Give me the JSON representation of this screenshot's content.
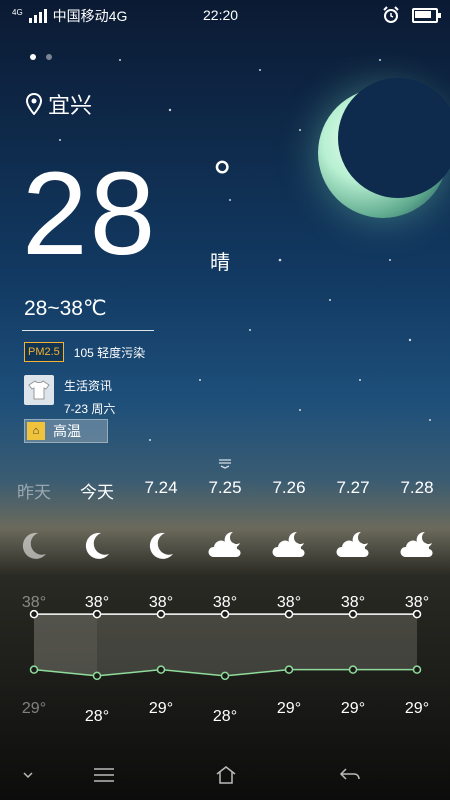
{
  "status": {
    "network": "4G",
    "carrier": "中国移动4G",
    "time": "22:20",
    "alarm_icon": "alarm-clock-icon",
    "battery_icon": "battery-icon"
  },
  "page_dots": [
    true,
    false
  ],
  "city": "宜兴",
  "current": {
    "temperature": "28",
    "degree_symbol": "°",
    "condition": "晴",
    "range": "28~38℃"
  },
  "aqi": {
    "badge": "PM2.5",
    "text": "105 轻度污染"
  },
  "life": {
    "title": "生活资讯",
    "date": "7-23 周六"
  },
  "alert": {
    "label": "高温"
  },
  "forecast": {
    "days": [
      {
        "label": "昨天",
        "icon": "crescent-moon-icon",
        "high": "38°",
        "low": "29°",
        "past": true
      },
      {
        "label": "今天",
        "icon": "crescent-moon-icon",
        "high": "38°",
        "low": "28°",
        "past": false
      },
      {
        "label": "7.24",
        "icon": "crescent-moon-icon",
        "high": "38°",
        "low": "29°",
        "past": false
      },
      {
        "label": "7.25",
        "icon": "cloud-moon-icon",
        "high": "38°",
        "low": "28°",
        "past": false
      },
      {
        "label": "7.26",
        "icon": "cloud-moon-icon",
        "high": "38°",
        "low": "29°",
        "past": false
      },
      {
        "label": "7.27",
        "icon": "cloud-moon-icon",
        "high": "38°",
        "low": "29°",
        "past": false
      },
      {
        "label": "7.28",
        "icon": "cloud-moon-icon",
        "high": "38°",
        "low": "29°",
        "past": false
      }
    ]
  },
  "chart_data": {
    "type": "line",
    "categories": [
      "昨天",
      "今天",
      "7.24",
      "7.25",
      "7.26",
      "7.27",
      "7.28"
    ],
    "series": [
      {
        "values": [
          38,
          38,
          38,
          38,
          38,
          38,
          38
        ],
        "color": "#ffffff"
      },
      {
        "values": [
          29,
          28,
          29,
          28,
          29,
          29,
          29
        ],
        "color": "#8fdc9a"
      }
    ]
  },
  "navbar": {
    "items": [
      "chevron-down-icon",
      "menu-icon",
      "home-icon",
      "back-icon"
    ]
  },
  "colors": {
    "aqi_accent": "#f2b233",
    "low_line": "#8fdc9a",
    "alert_icon": "#f0c33c"
  }
}
